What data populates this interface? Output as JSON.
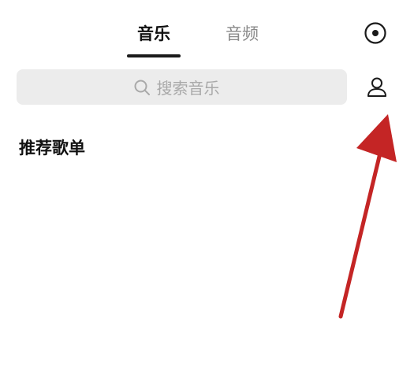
{
  "tabs": [
    {
      "label": "音乐",
      "active": true
    },
    {
      "label": "音频",
      "active": false
    }
  ],
  "search": {
    "placeholder": "搜索音乐"
  },
  "section": {
    "title": "推荐歌单"
  },
  "icons": {
    "record": "record-icon",
    "search": "search-icon",
    "profile": "user-icon"
  },
  "colors": {
    "active_tab": "#111111",
    "inactive_tab": "#8a8a8a",
    "search_bg": "#ececec",
    "placeholder": "#a9a9a9",
    "arrow": "#c42525"
  }
}
